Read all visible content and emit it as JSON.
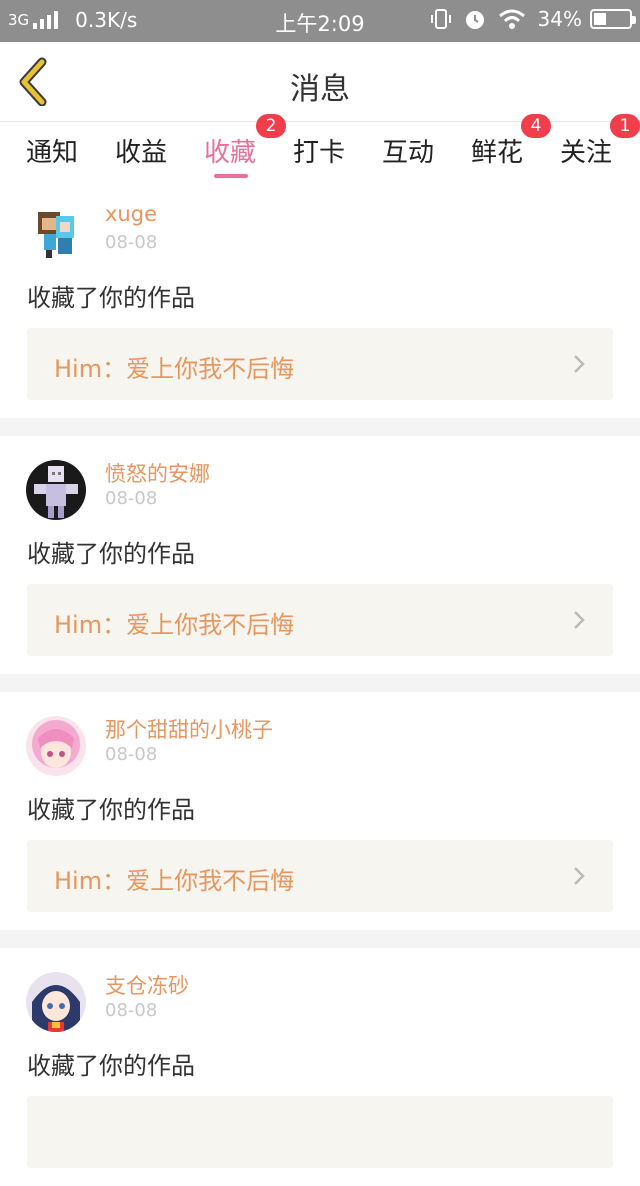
{
  "status_bar": {
    "network": "3G",
    "speed": "0.3K/s",
    "time": "上午2:09",
    "battery": "34%",
    "battery_level": 0.34,
    "icons": [
      "vibrate-icon",
      "alarm-icon",
      "wifi-icon",
      "battery-icon"
    ]
  },
  "header": {
    "title": "消息",
    "back_icon": "chevron-left-icon",
    "accent": "#e8c230"
  },
  "tabs": [
    {
      "label": "通知",
      "badge": "",
      "active": false
    },
    {
      "label": "收益",
      "badge": "",
      "active": false
    },
    {
      "label": "收藏",
      "badge": "2",
      "active": true
    },
    {
      "label": "打卡",
      "badge": "",
      "active": false
    },
    {
      "label": "互动",
      "badge": "",
      "active": false
    },
    {
      "label": "鲜花",
      "badge": "4",
      "active": false
    },
    {
      "label": "关注",
      "badge": "1",
      "active": false
    }
  ],
  "colors": {
    "active_tab": "#e8709a",
    "username": "#e8955e",
    "badge": "#f23d4b",
    "status_bar": "#8e8e8e"
  },
  "feed": [
    {
      "username": "xuge",
      "date": "08-08",
      "action": "收藏了你的作品",
      "work": "Him：爱上你我不后悔",
      "avatar": "pixel-character-avatar"
    },
    {
      "username": "愤怒的安娜",
      "date": "08-08",
      "action": "收藏了你的作品",
      "work": "Him：爱上你我不后悔",
      "avatar": "pixel-character-avatar"
    },
    {
      "username": "那个甜甜的小桃子",
      "date": "08-08",
      "action": "收藏了你的作品",
      "work": "Him：爱上你我不后悔",
      "avatar": "anime-girl-avatar"
    },
    {
      "username": "支仓冻砂",
      "date": "08-08",
      "action": "收藏了你的作品",
      "work": "",
      "avatar": "anime-girl-avatar"
    }
  ]
}
